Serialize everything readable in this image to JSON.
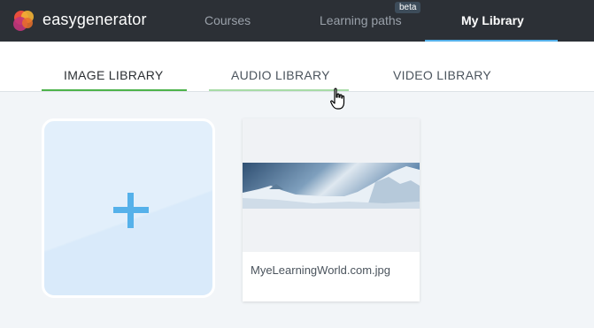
{
  "header": {
    "brand": "easygenerator",
    "nav": {
      "courses": "Courses",
      "learning_paths": "Learning paths",
      "learning_paths_badge": "beta",
      "my_library": "My Library"
    }
  },
  "library_tabs": {
    "image": "IMAGE LIBRARY",
    "audio": "AUDIO LIBRARY",
    "video": "VIDEO LIBRARY",
    "active": "IMAGE LIBRARY"
  },
  "images": [
    {
      "name": "MyeLearningWorld.com.jpg"
    }
  ],
  "colors": {
    "header_bg": "#2c3036",
    "accent_blue": "#55b1ea",
    "tab_active_green": "#4db34b",
    "page_bg": "#f2f5f8"
  }
}
